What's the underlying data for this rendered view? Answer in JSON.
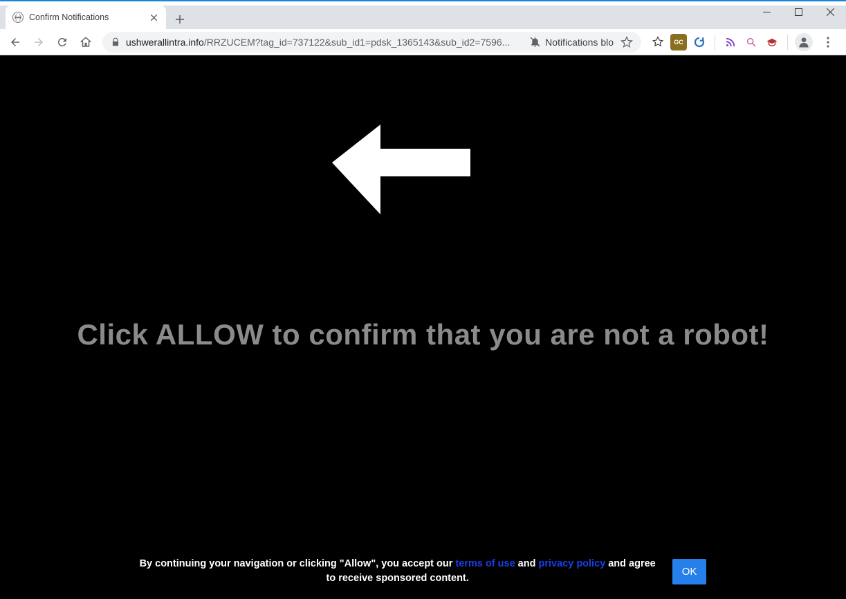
{
  "window": {
    "controls": {
      "min": "minimize",
      "max": "maximize",
      "close": "close"
    }
  },
  "tab": {
    "title": "Confirm Notifications"
  },
  "toolbar": {
    "url_domain": "ushwerallintra.info",
    "url_path": "/RRZUCEM?tag_id=737122&sub_id1=pdsk_1365143&sub_id2=7596...",
    "notifications_text": "Notifications blo"
  },
  "page": {
    "headline": "Click ALLOW to confirm that you are not a robot!",
    "footer_pre": "By continuing your navigation or clicking \"Allow\", you accept our ",
    "terms_link": "terms of use",
    "footer_mid": " and ",
    "privacy_link": "privacy policy",
    "footer_post": " and agree",
    "footer_line2": "to receive sponsored content.",
    "ok_label": "OK"
  }
}
